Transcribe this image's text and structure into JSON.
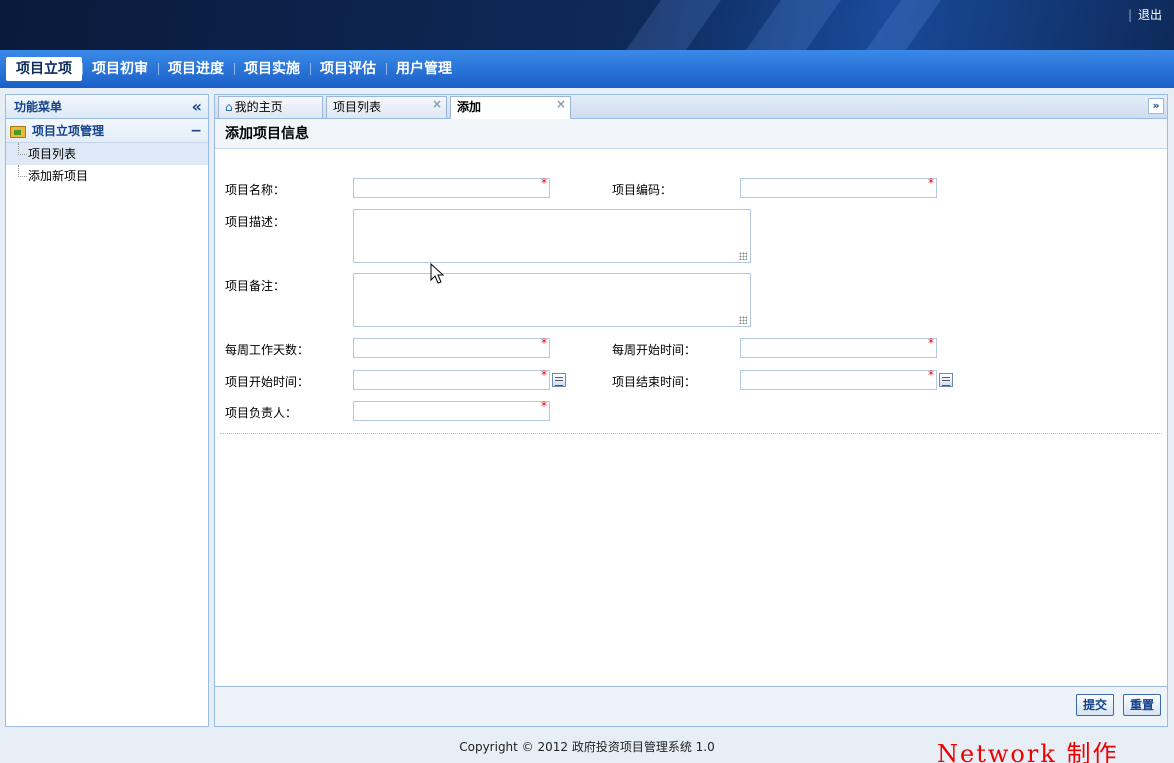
{
  "header": {
    "logout_label": "退出",
    "logout_sep": "|"
  },
  "nav": {
    "items": [
      {
        "label": "项目立项",
        "active": true
      },
      {
        "label": "项目初审"
      },
      {
        "label": "项目进度"
      },
      {
        "label": "项目实施"
      },
      {
        "label": "项目评估"
      },
      {
        "label": "用户管理"
      }
    ]
  },
  "sidebar": {
    "title": "功能菜单",
    "collapse_glyph": "«",
    "group": {
      "label": "项目立项管理",
      "toggle_glyph": "−"
    },
    "items": [
      {
        "label": "项目列表",
        "active": true
      },
      {
        "label": "添加新项目"
      }
    ]
  },
  "tabs": {
    "items": [
      {
        "label": "我的主页"
      },
      {
        "label": "项目列表"
      },
      {
        "label": "添加",
        "active": true
      }
    ],
    "close_glyph": "×",
    "more_glyph": "»",
    "home_glyph": "⌂"
  },
  "form": {
    "title": "添加项目信息",
    "required_mark": "*",
    "fields": {
      "name": {
        "label": "项目名称：",
        "value": ""
      },
      "code": {
        "label": "项目编码：",
        "value": ""
      },
      "desc": {
        "label": "项目描述：",
        "value": ""
      },
      "remark": {
        "label": "项目备注：",
        "value": ""
      },
      "workdays": {
        "label": "每周工作天数：",
        "value": ""
      },
      "week_start": {
        "label": "每周开始时间：",
        "value": ""
      },
      "start_time": {
        "label": "项目开始时间：",
        "value": ""
      },
      "end_time": {
        "label": "项目结束时间：",
        "value": ""
      },
      "owner": {
        "label": "项目负责人：",
        "value": ""
      }
    },
    "submit_label": "提交",
    "reset_label": "重置"
  },
  "footer": {
    "copyright": "Copyright © 2012 政府投资项目管理系统 1.0"
  },
  "watermark": "Network 制作",
  "colors": {
    "nav_blue": "#1a5fc8",
    "header_dark": "#0e2a5a",
    "border": "#99bbe8",
    "required": "#e00000"
  }
}
